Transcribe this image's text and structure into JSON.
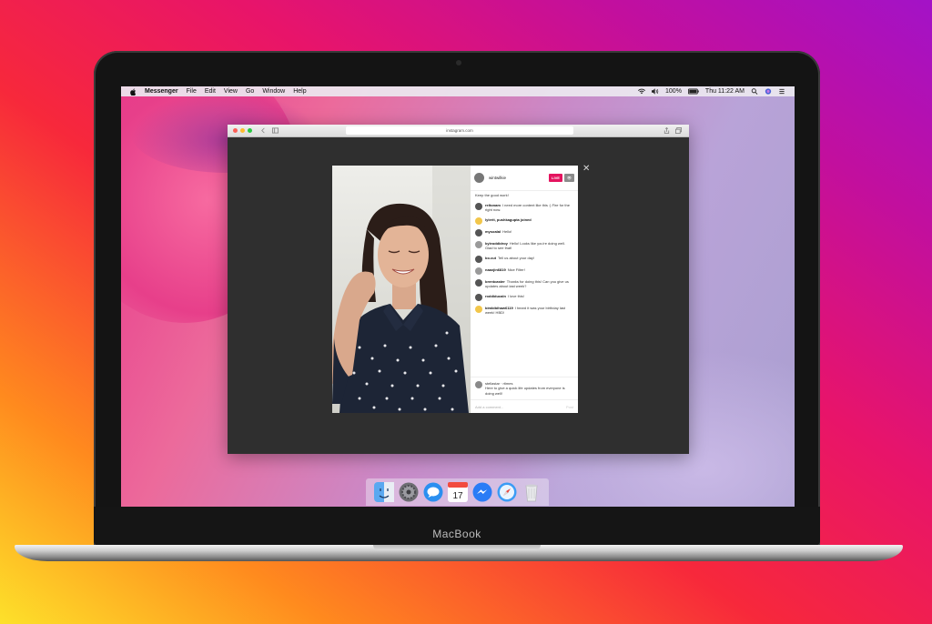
{
  "menubar": {
    "app_name": "Messenger",
    "items": [
      "File",
      "Edit",
      "View",
      "Go",
      "Window",
      "Help"
    ],
    "battery": "100%",
    "clock": "Thu 11:22 AM"
  },
  "browser": {
    "url": "instagram.com"
  },
  "live": {
    "username": "wintwilkie",
    "live_badge": "LIVE",
    "viewers": "",
    "first_comment": "Keep the good work!",
    "comments": [
      {
        "user": "reltonam",
        "text": "I need more content like this :) Fire for the right now."
      },
      {
        "user": "lylerit, pushkagupta joined",
        "text": ""
      },
      {
        "user": "mysoalal",
        "text": "Hello!"
      },
      {
        "user": "kyleoddidroy",
        "text": "Hello! Looks like you're doing well. Glad to see that!"
      },
      {
        "user": "bo.cut",
        "text": "Tell us about your day!"
      },
      {
        "user": "naaxjin6819",
        "text": "Nice Filter!"
      },
      {
        "user": "brentcaster",
        "text": "Thanks for doing this! Can you give us updates about last week?"
      },
      {
        "user": "roddiducaln",
        "text": "I love this!"
      },
      {
        "user": "bimbibihaw6119",
        "text": "I heard it was your birthday last week! HBD!"
      }
    ],
    "pinned": {
      "user": "stellastar · rtimes",
      "text": "Here to give a quick life updates from everyone is doing well!"
    },
    "composer_placeholder": "Add a comment...",
    "post_label": "Post"
  },
  "laptop_brand": "MacBook",
  "icons": [
    "apple-icon",
    "wifi-icon",
    "volume-icon",
    "battery-icon",
    "search-icon",
    "siri-icon",
    "menu-list-icon",
    "finder-icon",
    "system-preferences-icon",
    "messages-icon",
    "calendar-icon",
    "messenger-icon",
    "safari-icon",
    "trash-icon"
  ],
  "calendar_day": "17"
}
